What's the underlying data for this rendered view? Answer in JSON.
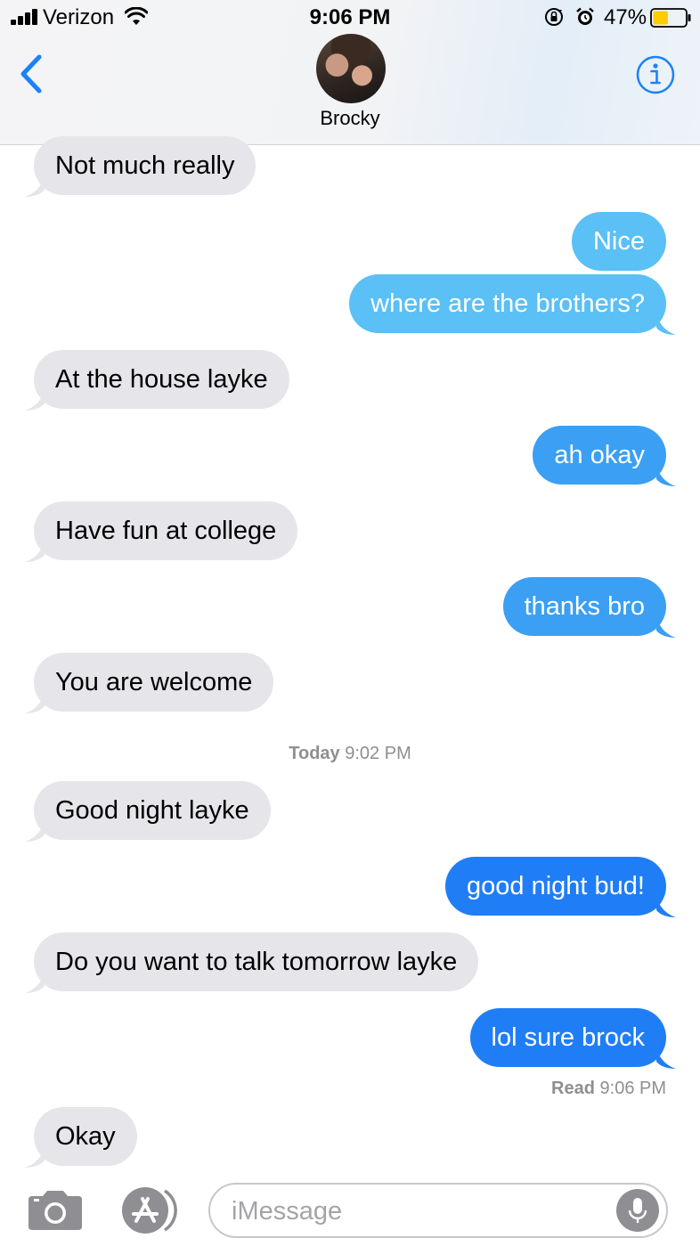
{
  "status_bar": {
    "carrier": "Verizon",
    "time": "9:06 PM",
    "battery": "47%",
    "battery_level": 0.47,
    "battery_color": "#ffcc00"
  },
  "header": {
    "contact_name": "Brocky",
    "back_icon": "chevron-left",
    "info_icon": "info-circle",
    "accent_color": "#1a82fb"
  },
  "messages": [
    {
      "from": "contact",
      "text": "Not much really"
    },
    {
      "from": "me",
      "text": "Nice"
    },
    {
      "from": "me",
      "text": "where are the brothers?"
    },
    {
      "from": "contact",
      "text": "At the house layke"
    },
    {
      "from": "me",
      "text": "ah okay"
    },
    {
      "from": "contact",
      "text": "Have fun at college"
    },
    {
      "from": "me",
      "text": "thanks bro"
    },
    {
      "from": "contact",
      "text": "You are welcome"
    },
    {
      "from": "contact",
      "text": "Good night layke"
    },
    {
      "from": "me",
      "text": "good night bud!"
    },
    {
      "from": "contact",
      "text": "Do you want to talk tomorrow layke"
    },
    {
      "from": "me",
      "text": "lol sure brock"
    },
    {
      "from": "contact",
      "text": "Okay"
    }
  ],
  "timestamp": {
    "day": "Today",
    "time": "9:02 PM"
  },
  "read_receipt": {
    "label": "Read",
    "time": "9:06 PM"
  },
  "input": {
    "placeholder": "iMessage"
  },
  "colors": {
    "incoming_bubble": "#e5e5ea",
    "outgoing_light": "#5ac0f5",
    "outgoing_mid": "#3b9ff3",
    "outgoing_deep": "#1f7ef5"
  }
}
